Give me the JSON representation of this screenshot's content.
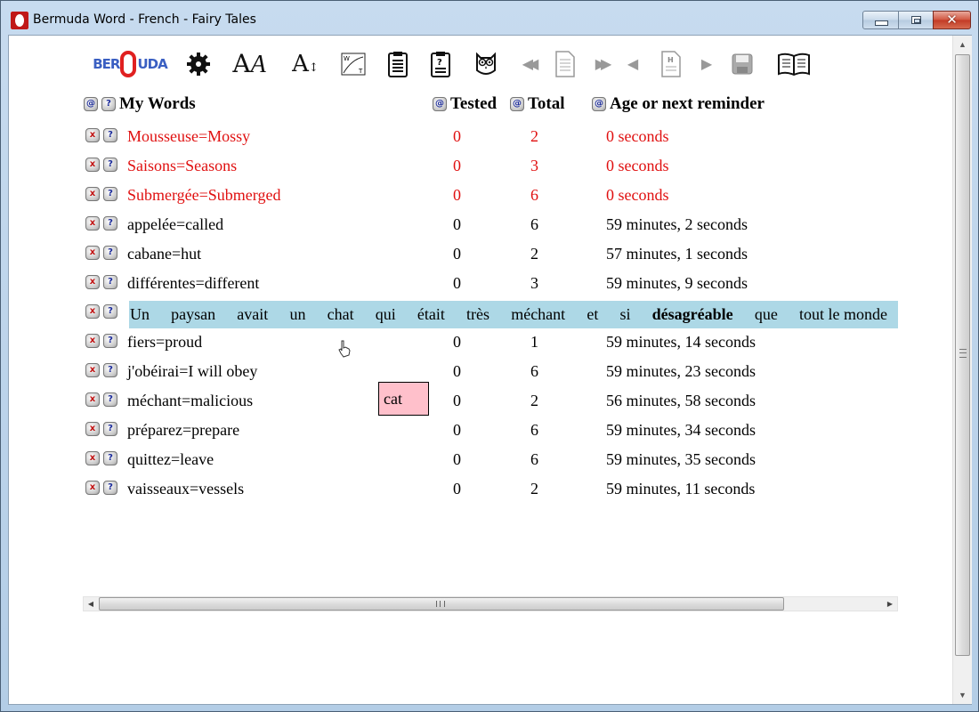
{
  "window": {
    "title": "Bermuda Word - French - Fairy Tales",
    "minimize_label": "",
    "maximize_label": "",
    "close_label": "✕"
  },
  "toolbar": {
    "logo_text_left": "BER",
    "logo_text_right": "UDA",
    "buttons": [
      {
        "icon": "gear-icon"
      },
      {
        "icon": "font-style-icon",
        "glyph": "AA"
      },
      {
        "icon": "font-size-icon",
        "glyph": "A↕"
      },
      {
        "icon": "graph-icon"
      },
      {
        "icon": "clipboard-list-icon"
      },
      {
        "icon": "clipboard-question-icon"
      },
      {
        "icon": "owl-icon"
      },
      {
        "icon": "rewind-icon",
        "glyph": "◀◀"
      },
      {
        "icon": "document-icon"
      },
      {
        "icon": "fast-forward-icon",
        "glyph": "▶▶"
      },
      {
        "icon": "previous-icon",
        "glyph": "◀"
      },
      {
        "icon": "document-h-icon"
      },
      {
        "icon": "next-icon",
        "glyph": "▶"
      },
      {
        "icon": "save-icon"
      },
      {
        "icon": "book-icon"
      }
    ]
  },
  "headers": {
    "my_words": "My Words",
    "tested": "Tested",
    "total": "Total",
    "age": "Age or next reminder",
    "at_glyph": "@",
    "q_glyph": "?"
  },
  "row_glyphs": {
    "delete": "x",
    "help": "?"
  },
  "rows": [
    {
      "word": "Mousseuse=Mossy",
      "tested": "0",
      "total": "2",
      "age": "0 seconds",
      "status": "due"
    },
    {
      "word": "Saisons=Seasons",
      "tested": "0",
      "total": "3",
      "age": "0 seconds",
      "status": "due"
    },
    {
      "word": "Submergée=Submerged",
      "tested": "0",
      "total": "6",
      "age": "0 seconds",
      "status": "due"
    },
    {
      "word": "appelée=called",
      "tested": "0",
      "total": "6",
      "age": "59 minutes, 2 seconds",
      "status": "normal"
    },
    {
      "word": "cabane=hut",
      "tested": "0",
      "total": "2",
      "age": "57 minutes, 1 seconds",
      "status": "normal"
    },
    {
      "word": "différentes=different",
      "tested": "0",
      "total": "3",
      "age": "59 minutes, 9 seconds",
      "status": "normal"
    },
    {
      "word": "fiers=proud",
      "tested": "0",
      "total": "1",
      "age": "59 minutes, 14 seconds",
      "status": "normal"
    },
    {
      "word": "j'obéirai=I will obey",
      "tested": "0",
      "total": "6",
      "age": "59 minutes, 23 seconds",
      "status": "normal"
    },
    {
      "word": "méchant=malicious",
      "tested": "0",
      "total": "2",
      "age": "56 minutes, 58 seconds",
      "status": "normal"
    },
    {
      "word": "préparez=prepare",
      "tested": "0",
      "total": "6",
      "age": "59 minutes, 34 seconds",
      "status": "normal"
    },
    {
      "word": "quittez=leave",
      "tested": "0",
      "total": "6",
      "age": "59 minutes, 35 seconds",
      "status": "normal"
    },
    {
      "word": "vaisseaux=vessels",
      "tested": "0",
      "total": "2",
      "age": "59 minutes, 11 seconds",
      "status": "normal"
    }
  ],
  "sentence": {
    "words": [
      "Un",
      "paysan",
      "avait",
      "un",
      "chat",
      "qui",
      "était",
      "très",
      "méchant",
      "et",
      "si",
      "désagréable",
      "que",
      "tout le monde"
    ],
    "bold_word": "désagréable"
  },
  "popup": {
    "text": "cat"
  },
  "colors": {
    "due_text": "#e01010",
    "sentence_bg": "#add8e6",
    "popup_bg": "#ffc0cb"
  }
}
